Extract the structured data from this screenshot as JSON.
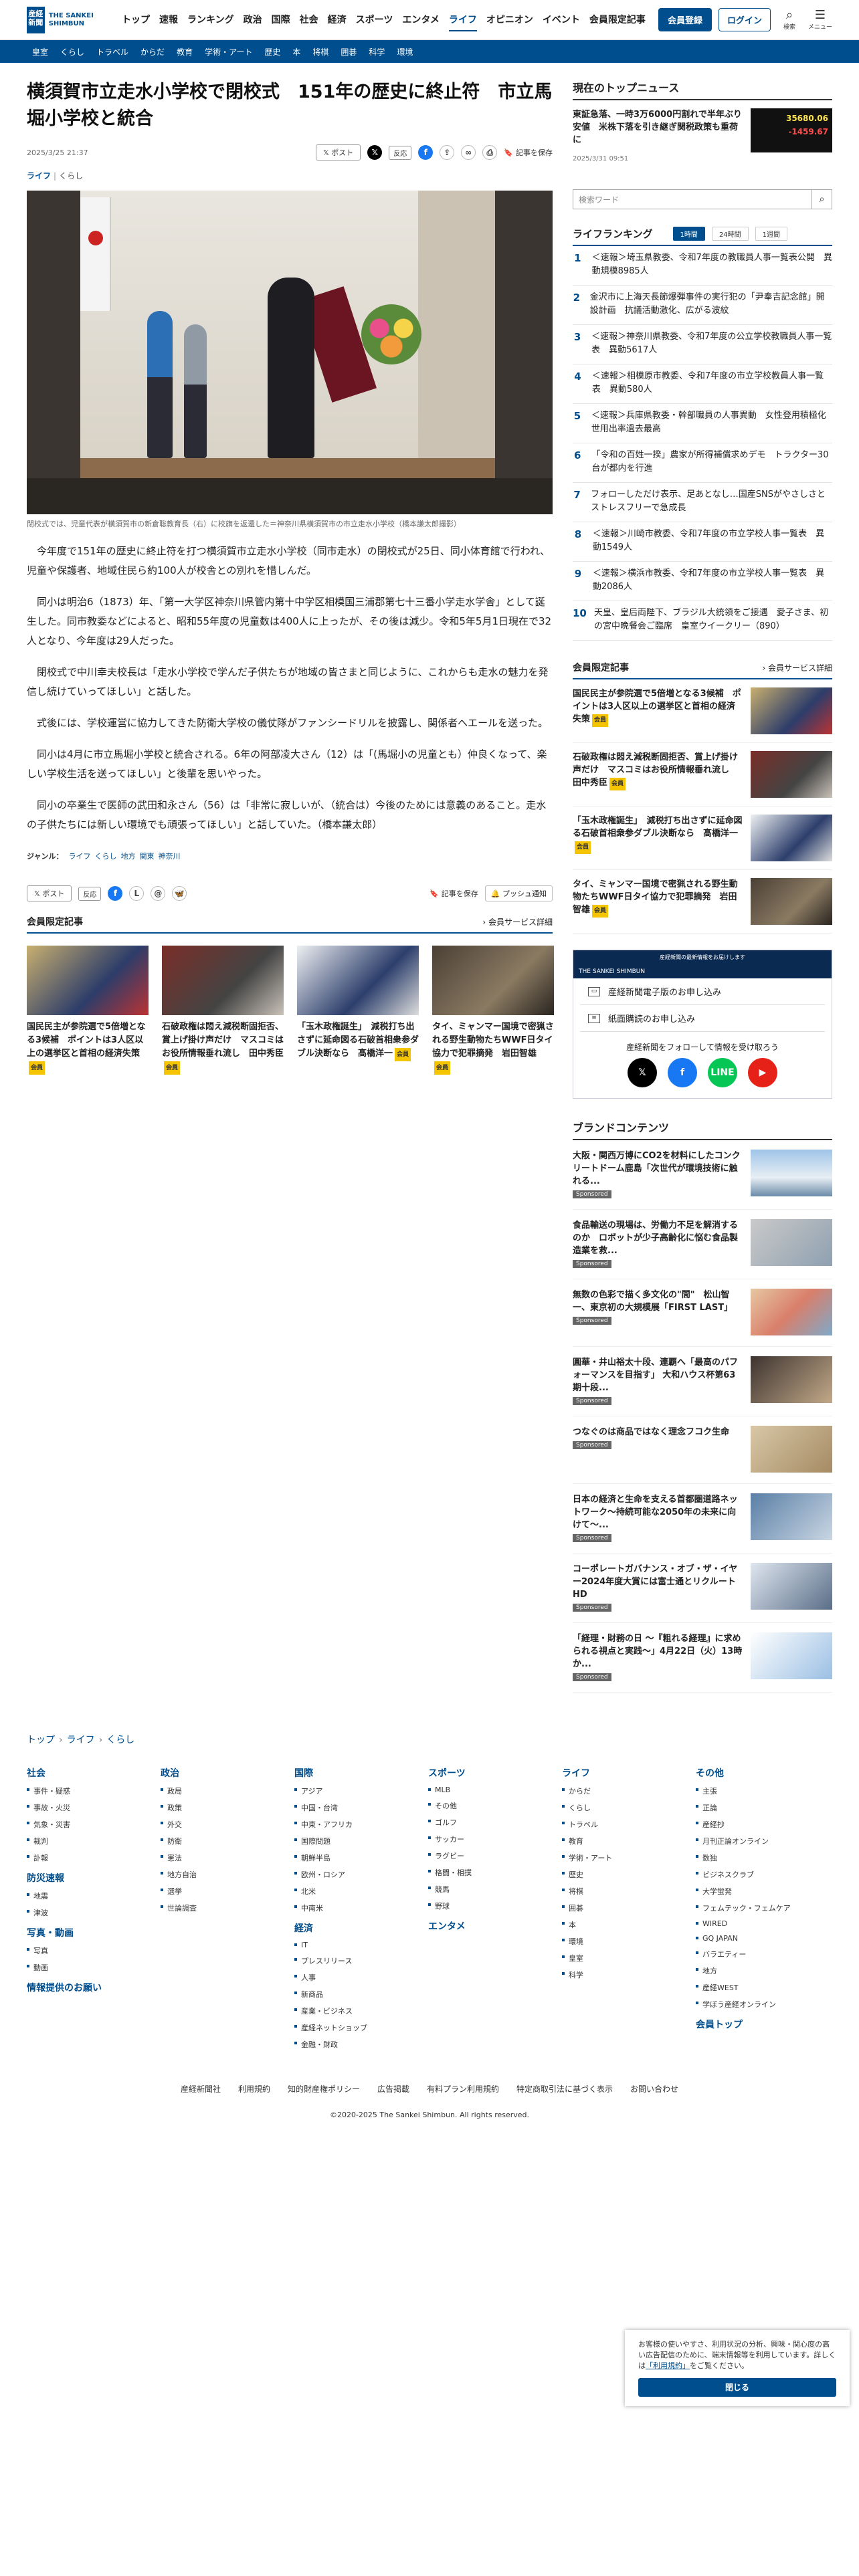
{
  "header": {
    "logo_mark": "産経新聞",
    "logo_text": "THE SANKEI SHIMBUN",
    "nav": [
      "トップ",
      "速報",
      "ランキング",
      "政治",
      "国際",
      "社会",
      "経済",
      "スポーツ",
      "エンタメ",
      "ライフ",
      "オピニオン",
      "イベント",
      "会員限定記事"
    ],
    "register_label": "会員登録",
    "login_label": "ログイン",
    "search_label": "検索",
    "menu_label": "メニュー"
  },
  "subnav": [
    "皇室",
    "くらし",
    "トラベル",
    "からだ",
    "教育",
    "学術・アート",
    "歴史",
    "本",
    "将棋",
    "囲碁",
    "科学",
    "環境"
  ],
  "article": {
    "title": "横須賀市立走水小学校で閉校式　151年の歴史に終止符　市立馬堀小学校と統合",
    "date": "2025/3/25 21:37",
    "post_label": "ポスト",
    "react_label": "反応",
    "save_label": "記事を保存",
    "category": "ライフ",
    "subcategory": "くらし",
    "caption": "閉校式では、児童代表が横須賀市の新倉聡教育長（右）に校旗を返還した＝神奈川県横須賀市の市立走水小学校（橋本謙太郎撮影）",
    "paragraphs": [
      "今年度で151年の歴史に終止符を打つ横須賀市立走水小学校（同市走水）の閉校式が25日、同小体育館で行われ、児童や保護者、地域住民ら約100人が校舎との別れを惜しんだ。",
      "同小は明治6（1873）年、「第一大学区神奈川県管内第十中学区相模国三浦郡第七十三番小学走水学舎」として誕生した。同市教委などによると、昭和55年度の児童数は400人に上ったが、その後は減少。令和5年5月1日現在で32人となり、今年度は29人だった。",
      "閉校式で中川幸夫校長は「走水小学校で学んだ子供たちが地域の皆さまと同じように、これからも走水の魅力を発信し続けていってほしい」と話した。",
      "式後には、学校運営に協力してきた防衛大学校の儀仗隊がファンシードリルを披露し、関係者へエールを送った。",
      "同小は4月に市立馬堀小学校と統合される。6年の阿部凌大さん（12）は「(馬堀小の児童とも）仲良くなって、楽しい学校生活を送ってほしい」と後輩を思いやった。",
      "同小の卒業生で医師の武田和永さん（56）は「非常に寂しいが、（統合は）今後のためには意義のあること。走水の子供たちには新しい環境でも頑張ってほしい」と話していた。（橋本謙太郎）"
    ],
    "genre_label": "ジャンル：",
    "genre_links": [
      "ライフ",
      "くらし",
      "地方",
      "関東",
      "神奈川"
    ],
    "push_label": "プッシュ通知"
  },
  "members": {
    "title": "会員限定記事",
    "more": "会員サービス詳細",
    "lock": "会員",
    "items": [
      "国民民主が参院選で5倍増となる3候補　ポイントは3人区以上の選挙区と首相の経済失策",
      "石破政権は悶え減税断固拒否、賞上げ掛け声だけ　マスコミはお役所情報垂れ流し　田中秀臣",
      "「玉木政権誕生」　減税打ち出さずに延命図る石破首相衆参ダブル決断なら　髙橋洋一",
      "タイ、ミャンマー国境で密猟される野生動物たちWWF日タイ協力で犯罪摘発　岩田智雄"
    ]
  },
  "sidebar": {
    "topnews_title": "現在のトップニュース",
    "topnews_text": "東証急落、一時3万6000円割れで半年ぶり安値　米株下落を引き継ぎ関税政策も重荷に",
    "topnews_date": "2025/3/31 09:51",
    "chart_n1": "35680.06",
    "chart_n2": "-1459.67",
    "search_placeholder": "検索ワード",
    "ranking_title": "ライフランキング",
    "ranking_tabs": [
      "1時間",
      "24時間",
      "1週間"
    ],
    "ranking": [
      "＜速報＞埼玉県教委、令和7年度の教職員人事一覧表公開　異動規模8985人",
      "金沢市に上海天長節爆弾事件の実行犯の「尹奉吉記念館」開設計画　抗議活動激化、広がる波紋",
      "＜速報＞神奈川県教委、令和7年度の公立学校教職員人事一覧表　異動5617人",
      "＜速報＞相模原市教委、令和7年度の市立学校教員人事一覧表　異動580人",
      "＜速報＞兵庫県教委・幹部職員の人事異動　女性登用積極化　世用出率過去最高",
      "「令和の百姓一揆」農家が所得補償求めデモ　トラクター30台が都内を行進",
      "フォローしただけ表示、足あとなし…国産SNSがやさしさとストレスフリーで急成長",
      "＜速報＞川崎市教委、令和7年度の市立学校人事一覧表　異動1549人",
      "＜速報＞横浜市教委、令和7年度の市立学校人事一覧表　異動2086人",
      "天皇、皇后両陛下、ブラジル大統領をご接遇　愛子さま、初の宮中晩餐会ご臨席　皇室ウイークリー（890）"
    ],
    "members_title": "会員限定記事",
    "members_more": "会員サービス詳細",
    "promo_bar": "産経新聞の最新情報をお届けします",
    "promo_bar2": "THE SANKEI SHIMBUN",
    "promo_rows": [
      "産経新聞電子版のお申し込み",
      "紙面購読のお申し込み"
    ],
    "follow_text": "産経新聞をフォローして情報を受け取ろう",
    "brand_title": "ブランドコンテンツ",
    "sponsored": "Sponsored",
    "brand": [
      "大阪・関西万博にCO2を材料にしたコンクリートドーム鹿島「次世代が環境技術に触れる...",
      "食品輸送の現場は、労働力不足を解消するのか　ロボットが少子高齢化に悩む食品製造業を救...",
      "無数の色彩で描く多文化の\"間\"　松山智一、東京初の大規模展「FIRST LAST」",
      "圓華・井山裕太十段、連覇へ「最高のパフォーマンスを目指す」 大和ハウス杯第63期十段...",
      "つなぐのは商品ではなく理念フコク生命",
      "日本の経済と生命を支える首都圏道路ネットワーク〜持続可能な2050年の未来に向けて〜...",
      "コーポレートガバナンス・オブ・ザ・イヤー2024年度大賞には富士通とリクルートHD",
      "「経理・財務の日 〜『粗れる経理』に求められる視点と実践〜」4月22日（火）13時か..."
    ]
  },
  "footer": {
    "breadcrumb": [
      "トップ",
      "ライフ",
      "くらし"
    ],
    "cols": [
      {
        "groups": [
          {
            "h": "社会",
            "items": [
              "事件・疑惑",
              "事故・火災",
              "気象・災害",
              "裁判",
              "訃報"
            ]
          },
          {
            "h": "防災速報",
            "items": [
              "地震",
              "津波"
            ]
          },
          {
            "h": "写真・動画",
            "items": [
              "写真",
              "動画"
            ]
          },
          {
            "h": "情報提供のお願い",
            "items": []
          }
        ]
      },
      {
        "groups": [
          {
            "h": "政治",
            "items": [
              "政局",
              "政策",
              "外交",
              "防衛",
              "憲法",
              "地方自治",
              "選挙",
              "世論調査"
            ]
          }
        ]
      },
      {
        "groups": [
          {
            "h": "国際",
            "items": [
              "アジア",
              "中国・台湾",
              "中東・アフリカ",
              "国際問題",
              "朝鮮半島",
              "欧州・ロシア",
              "北米",
              "中南米"
            ]
          },
          {
            "h": "経済",
            "items": [
              "IT",
              "プレスリリース",
              "人事",
              "新商品",
              "産業・ビジネス",
              "産経ネットショップ",
              "金融・財政"
            ]
          }
        ]
      },
      {
        "groups": [
          {
            "h": "スポーツ",
            "items": [
              "MLB",
              "その他",
              "ゴルフ",
              "サッカー",
              "ラグビー",
              "格闘・相撲",
              "競馬",
              "野球"
            ]
          },
          {
            "h": "エンタメ",
            "items": []
          }
        ]
      },
      {
        "groups": [
          {
            "h": "ライフ",
            "items": [
              "からだ",
              "くらし",
              "トラベル",
              "教育",
              "学術・アート",
              "歴史",
              "将棋",
              "囲碁",
              "本",
              "環境",
              "皇室",
              "科学"
            ]
          }
        ]
      },
      {
        "groups": [
          {
            "h": "その他",
            "items": [
              "主張",
              "正論",
              "産経抄",
              "月刊正論オンライン",
              "数独",
              "ビジネスクラブ",
              "大学蛍発",
              "フェムテック・フェムケア",
              "WIRED",
              "GQ JAPAN",
              "バラエティー",
              "地方",
              "産経WEST",
              "学ぼう産経オンライン"
            ]
          },
          {
            "h": "会員トップ",
            "items": []
          }
        ]
      }
    ],
    "links": [
      "産経新聞社",
      "利用規約",
      "知的財産権ポリシー",
      "広告掲載",
      "有料プラン利用規約",
      "特定商取引法に基づく表示",
      "お問い合わせ"
    ],
    "copyright": "©2020-2025 The Sankei Shimbun. All rights reserved."
  },
  "cookie": {
    "text": "お客様の使いやすさ、利用状況の分析、興味・関心度の高い広告配信のために、端末情報等を利用しています。詳しくは",
    "link": "「利用規約」",
    "text2": "をご覧ください。",
    "ok": "閉じる"
  },
  "colors": {
    "brand": "#004e8d",
    "accent_gold": "#f5c400"
  }
}
